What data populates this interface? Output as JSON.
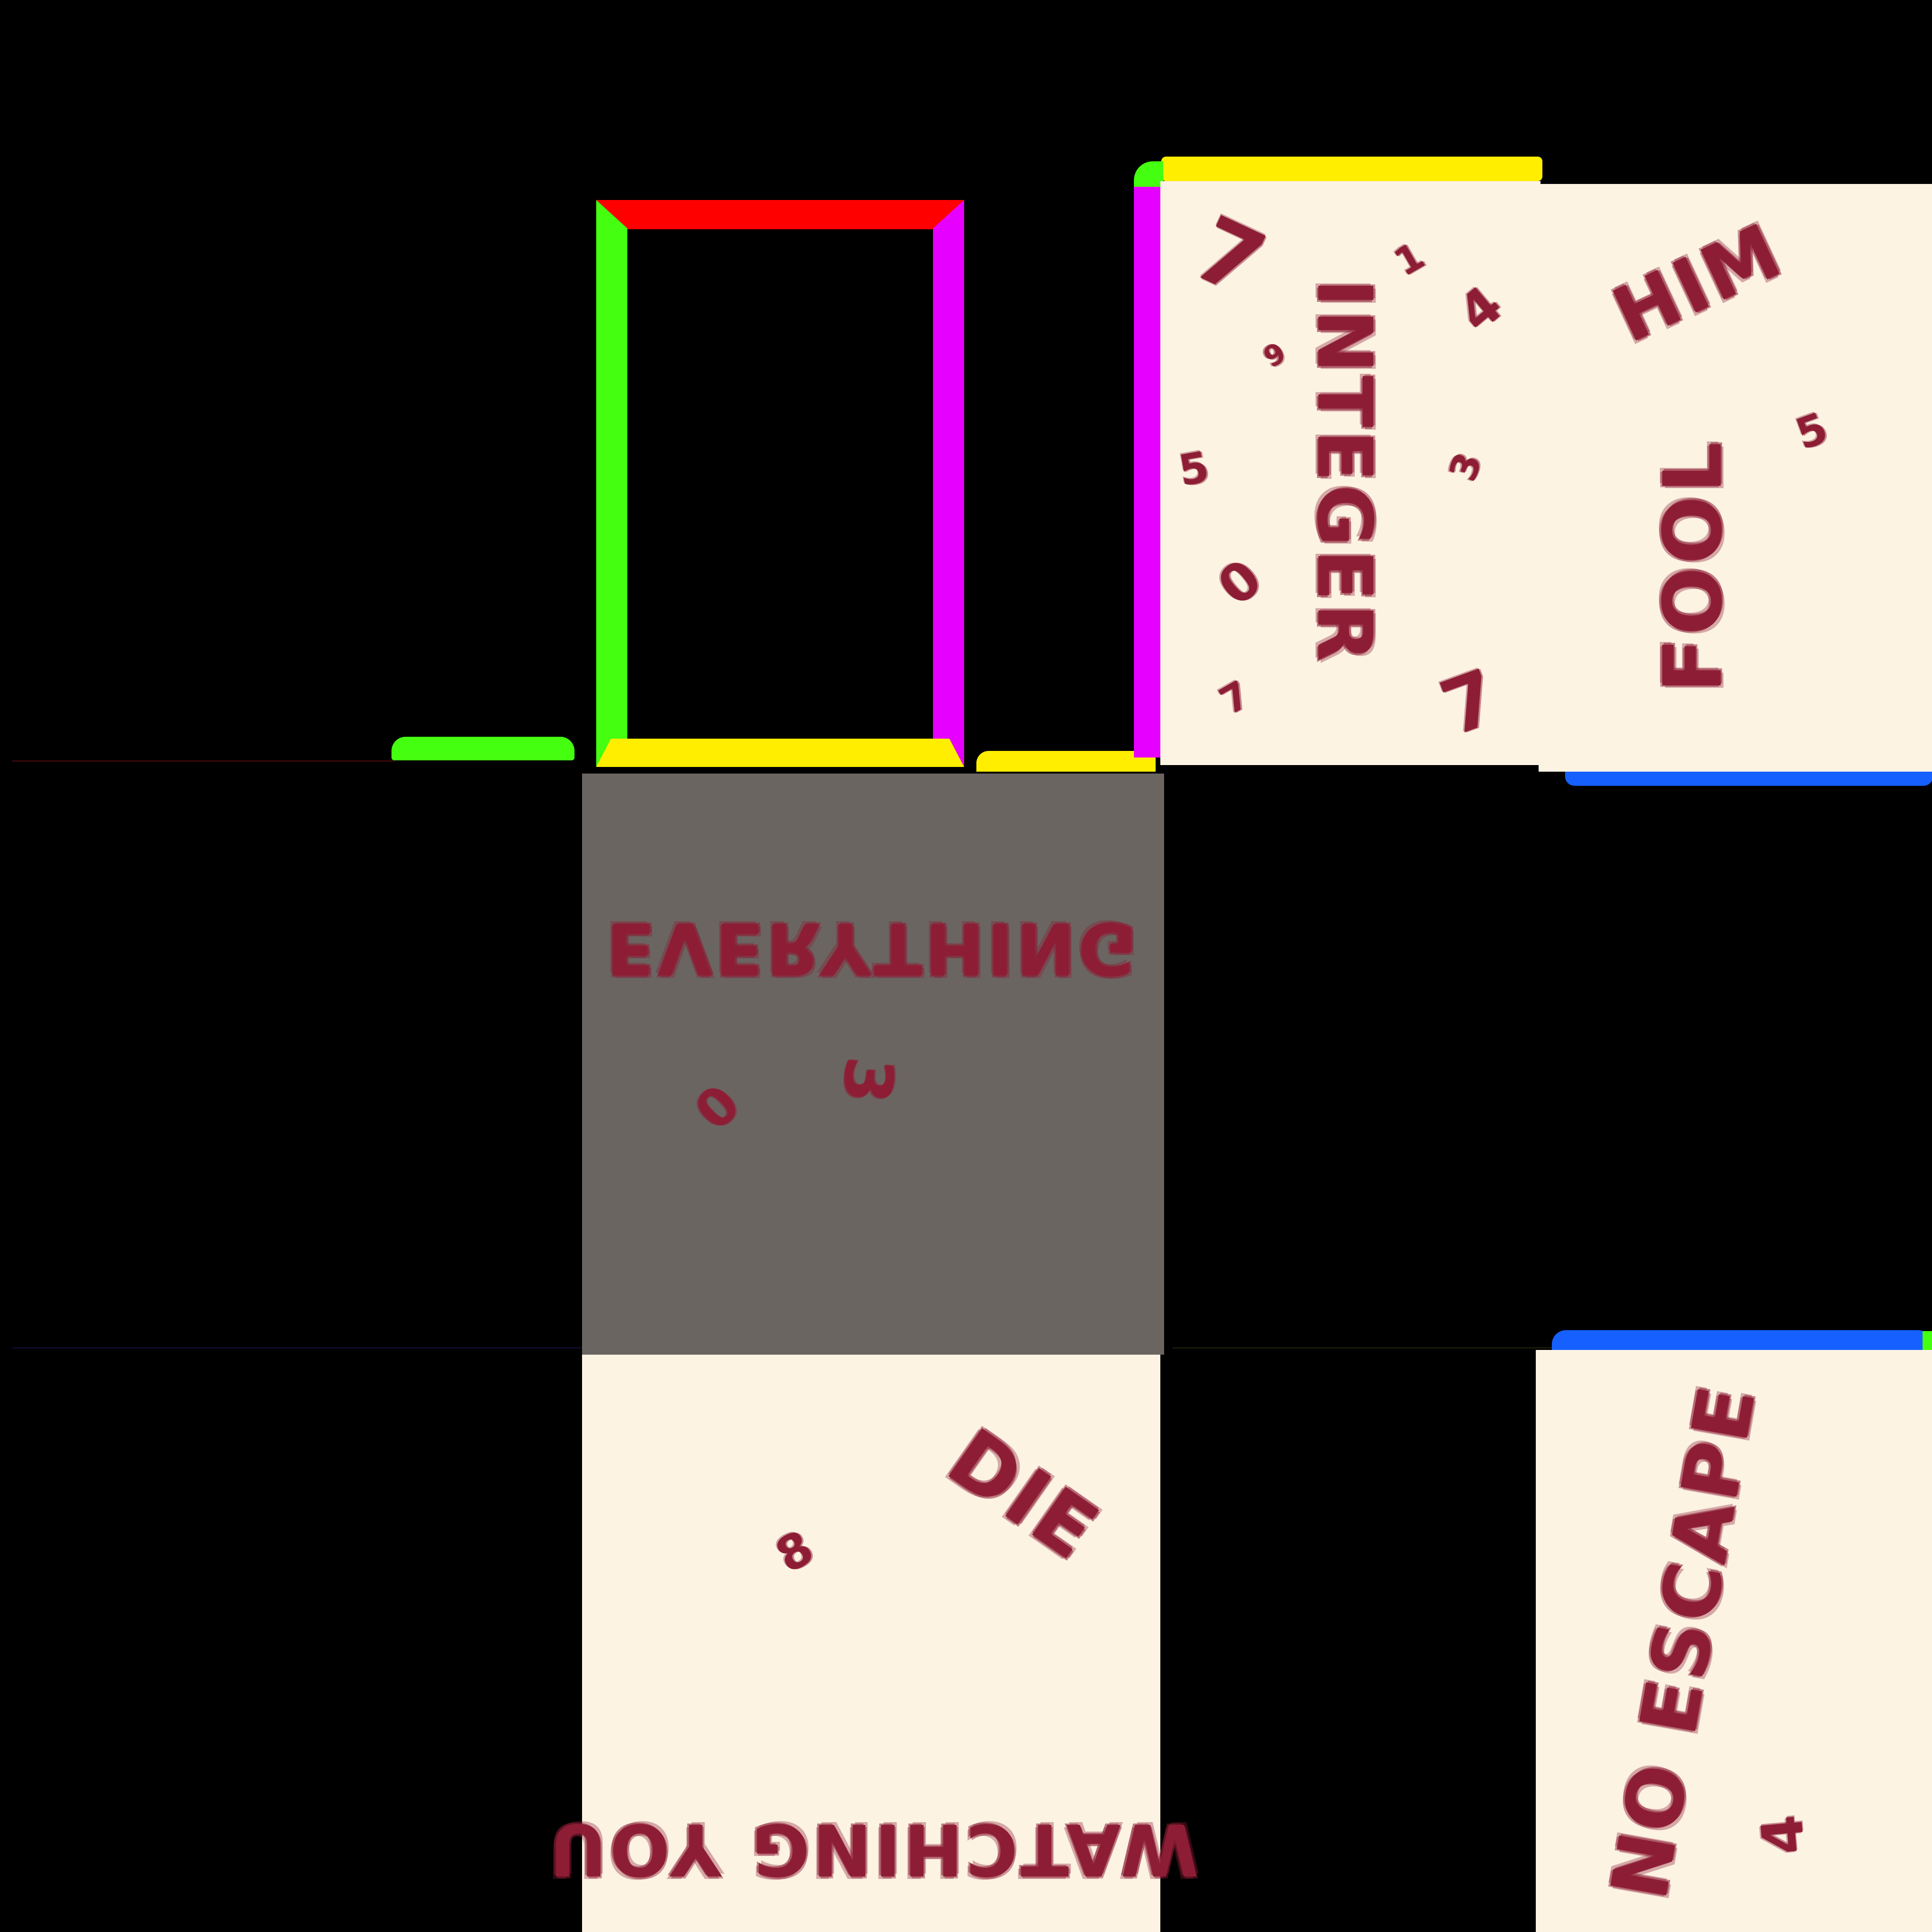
{
  "texture": {
    "top_right_panel": {
      "words": [
        "INTEGER",
        "HIM",
        "FOOL"
      ],
      "digits": [
        "7",
        "1",
        "4",
        "6",
        "3",
        "5",
        "0",
        "7",
        "7",
        "5"
      ]
    },
    "center_panel": {
      "words": [
        "EVERYTHING"
      ],
      "digits": [
        "0",
        "3"
      ]
    },
    "bottom_center_panel": {
      "words": [
        "DIE",
        "WATCHING YOU"
      ],
      "digits": [
        "8"
      ]
    },
    "bottom_right_panel": {
      "words": [
        "NO ESCAPE"
      ],
      "digits": [
        "4"
      ]
    },
    "colors": {
      "background": "#000000",
      "paper": "#fcf3e3",
      "grey_panel": "#6b6562",
      "ink": "#8d1d35",
      "edge_red": "#ff0000",
      "edge_green": "#44ff10",
      "edge_magenta": "#e600ff",
      "edge_yellow": "#ffee00",
      "edge_blue": "#1560ff"
    }
  }
}
